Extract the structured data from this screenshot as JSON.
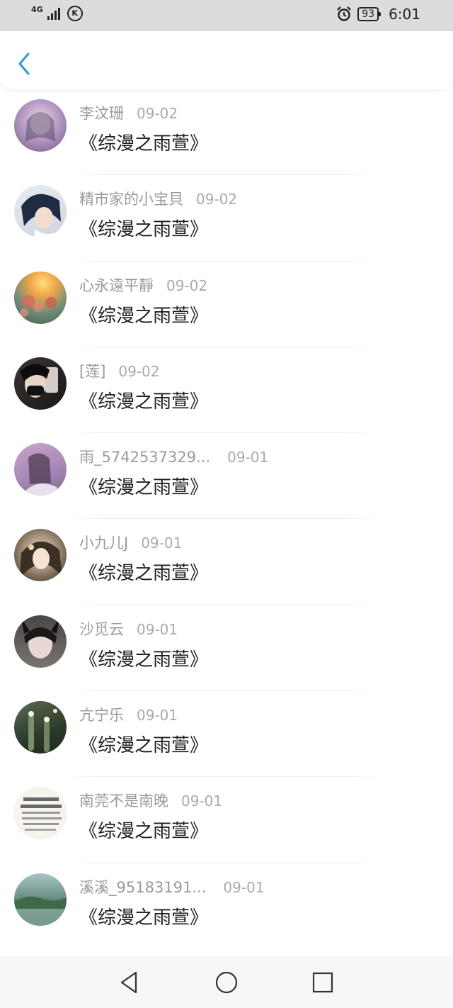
{
  "status_bar": {
    "network": "4G",
    "battery": "93",
    "time": "6:01"
  },
  "header": {
    "back_icon": "chevron-left-icon",
    "accent_color": "#2b9be0"
  },
  "list": [
    {
      "name": "李汶珊",
      "date": "09-02",
      "title": "《综漫之雨萱》"
    },
    {
      "name": "精市家的小宝貝",
      "date": "09-02",
      "title": "《综漫之雨萱》"
    },
    {
      "name": "心永遠平靜",
      "date": "09-02",
      "title": "《综漫之雨萱》"
    },
    {
      "name": "[莲]",
      "date": "09-02",
      "title": "《综漫之雨萱》"
    },
    {
      "name": "雨_5742537329...",
      "date": "09-01",
      "title": "《综漫之雨萱》"
    },
    {
      "name": "小九儿J",
      "date": "09-01",
      "title": "《综漫之雨萱》"
    },
    {
      "name": "沙觅云",
      "date": "09-01",
      "title": "《综漫之雨萱》"
    },
    {
      "name": "亢宁乐",
      "date": "09-01",
      "title": "《综漫之雨萱》"
    },
    {
      "name": "南莞不是南晚",
      "date": "09-01",
      "title": "《综漫之雨萱》"
    },
    {
      "name": "溪溪_95183191...",
      "date": "09-01",
      "title": "《综漫之雨萱》"
    }
  ],
  "nav_bar": {
    "back_icon": "triangle-back-icon",
    "home_icon": "circle-home-icon",
    "recents_icon": "square-recents-icon"
  }
}
